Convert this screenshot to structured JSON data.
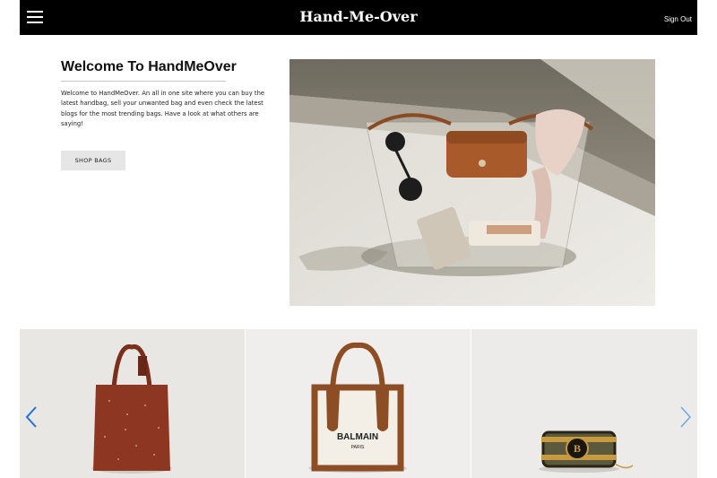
{
  "header": {
    "brand": "Hand-Me-Over",
    "sign_out": "Sign Out",
    "menu_icon": "hamburger-menu-icon"
  },
  "hero": {
    "title": "Welcome To HandMeOver",
    "description": "Welcome to HandMeOver. An all in one site where you can buy the latest handbag, sell your unwanted bag and even check the latest blogs for the most trending bags. Have a look at what others are saying!",
    "button_label": "SHOP BAGS",
    "image": "clear-tote-bag-photo"
  },
  "carousel": {
    "prev_icon": "chevron-left-icon",
    "next_icon": "chevron-right-icon",
    "accent_color": "#1a73d9",
    "slides": [
      {
        "image": "rust-suede-tote-photo"
      },
      {
        "image": "balmain-canvas-tote-photo",
        "brand_text": "BALMAIN",
        "brand_sub": "PARIS"
      },
      {
        "image": "balmain-box-bag-photo",
        "brand_text": "B"
      }
    ]
  }
}
